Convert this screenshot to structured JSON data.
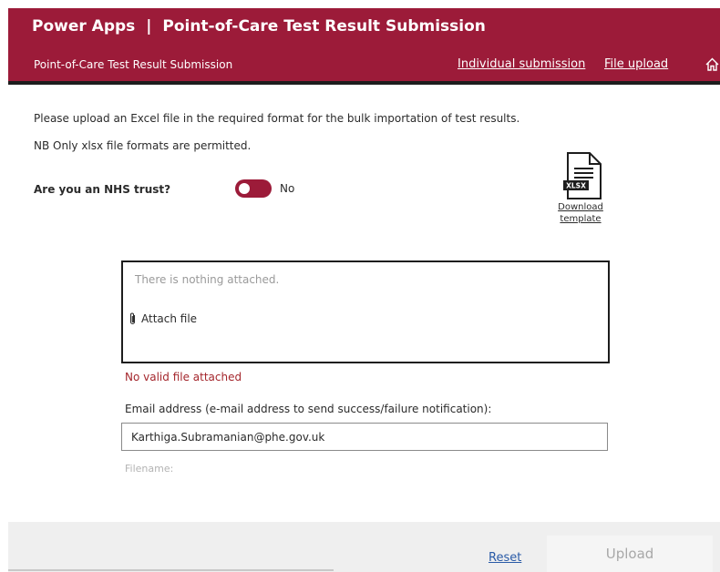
{
  "header": {
    "app_name": "Power Apps",
    "separator": "|",
    "page_title": "Point-of-Care Test Result Submission",
    "subbar_title": "Point-of-Care Test Result Submission",
    "nav": {
      "individual_submission": "Individual submission",
      "file_upload": "File upload"
    },
    "home_icon": "home-icon"
  },
  "instructions": {
    "line1": "Please upload an Excel file in the required format for the bulk importation of test results.",
    "line2": "NB Only xlsx file formats are permitted."
  },
  "nhs_trust": {
    "label": "Are you an NHS trust?",
    "value": "No",
    "toggle_on": false
  },
  "template": {
    "icon_text": "XLSX",
    "download_line1": "Download",
    "download_line2": "template"
  },
  "attachments": {
    "empty_text": "There is nothing attached.",
    "attach_label": "Attach file",
    "error": "No valid file attached"
  },
  "email": {
    "label": "Email address (e-mail address to send success/failure notification):",
    "value": "Karthiga.Subramanian@phe.gov.uk"
  },
  "filename": {
    "label": "Filename:"
  },
  "footer": {
    "reset_label": "Reset",
    "upload_label": "Upload"
  },
  "colors": {
    "brand": "#9c1b39",
    "error": "#a4262c",
    "link": "#2a5ba7"
  }
}
